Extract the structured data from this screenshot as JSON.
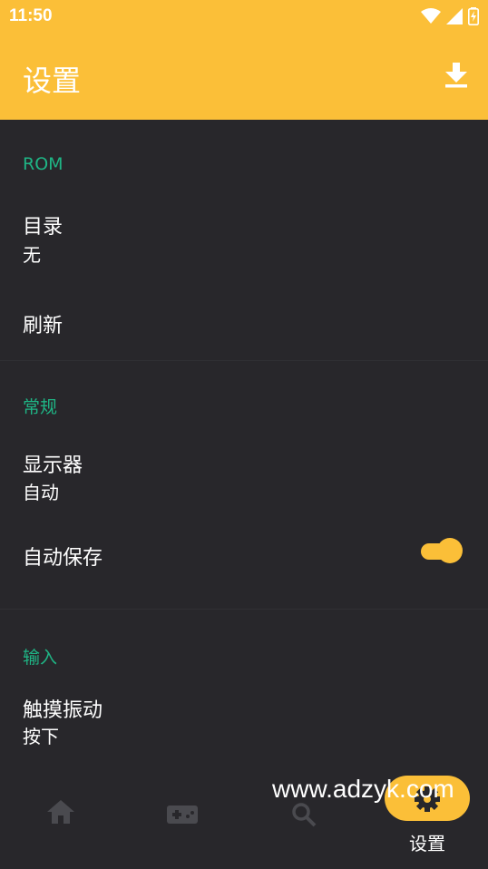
{
  "status_bar": {
    "time": "11:50"
  },
  "app_bar": {
    "title": "设置",
    "download_icon": "download-icon"
  },
  "sections": {
    "rom": {
      "header": "ROM",
      "directory": {
        "title": "目录",
        "value": "无"
      },
      "refresh": {
        "title": "刷新"
      }
    },
    "general": {
      "header": "常规",
      "display": {
        "title": "显示器",
        "value": "自动"
      },
      "autosave": {
        "title": "自动保存",
        "enabled": true
      }
    },
    "input": {
      "header": "输入",
      "haptics": {
        "title": "触摸振动",
        "value": "按下"
      }
    }
  },
  "bottom_nav": {
    "items": [
      {
        "icon": "home-icon"
      },
      {
        "icon": "gamepad-icon"
      },
      {
        "icon": "search-icon"
      },
      {
        "icon": "gear-icon",
        "label": "设置",
        "active": true
      }
    ]
  },
  "watermark": "www.adzyk.com",
  "colors": {
    "accent": "#fbbf38",
    "section_header": "#1fb585",
    "background": "#28272b"
  }
}
